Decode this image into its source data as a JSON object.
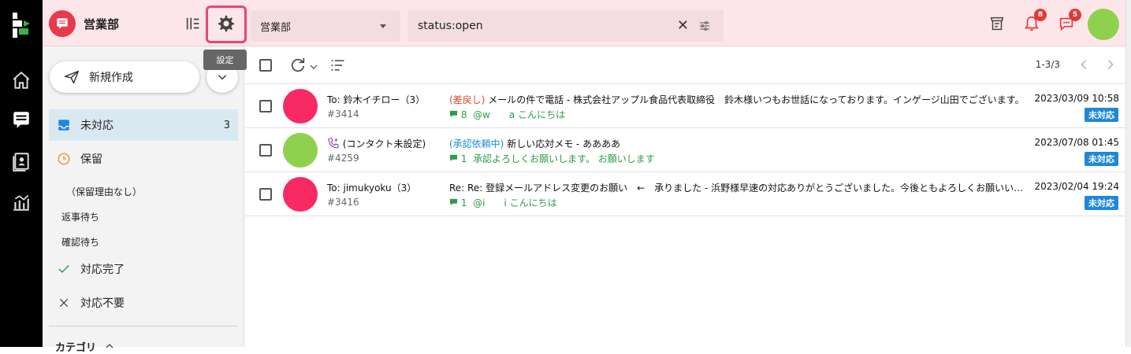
{
  "header": {
    "app_name": "営業部",
    "settings_tooltip": "設定",
    "inbox_select": "営業部",
    "search_value": "status:open",
    "notification_badge": "8",
    "mention_badge": "5"
  },
  "sidebar": {
    "compose_label": "新規作成",
    "items": [
      {
        "label": "未対応",
        "count": "3"
      },
      {
        "label": "保留"
      },
      {
        "label": "（保留理由なし）"
      },
      {
        "label": "返事待ち"
      },
      {
        "label": "確認待ち"
      },
      {
        "label": "対応完了"
      },
      {
        "label": "対応不要"
      }
    ],
    "category_label": "カテゴリ"
  },
  "toolbar": {
    "pager": "1-3/3"
  },
  "messages": [
    {
      "to": "To: 鈴木イチロー（3）",
      "number": "#3414",
      "tag": "(差戻し)",
      "subject": " メールの件で電話 - 株式会社アップル食品代表取締役　鈴木様いつもお世話になっております。インゲージ山田でございます。",
      "comment_count": "8",
      "comment": "@w　　a こんにちは",
      "date": "2023/03/09 10:58",
      "status": "未対応",
      "avatar_color": "#f72a63"
    },
    {
      "to": "(コンタクト未設定)",
      "number": "#4259",
      "tag": "(承認依頼中)",
      "subject": " 新しい応対メモ - ああああ",
      "comment_count": "1",
      "comment": "承認よろしくお願いします。 お願いします",
      "date": "2023/07/08 01:45",
      "status": "未対応",
      "avatar_color": "#8fd14f"
    },
    {
      "to": "To: jimukyoku（3）",
      "number": "#3416",
      "tag": "",
      "subject": "Re: Re: 登録メールアドレス変更のお願い　←　承りました - 浜野様早速の対応ありがとうございました。今後ともよろしくお願いいたします。",
      "comment_count": "1",
      "comment": "@i　　i こんにちは",
      "date": "2023/02/04 19:24",
      "status": "未対応",
      "avatar_color": "#f72a63"
    }
  ]
}
